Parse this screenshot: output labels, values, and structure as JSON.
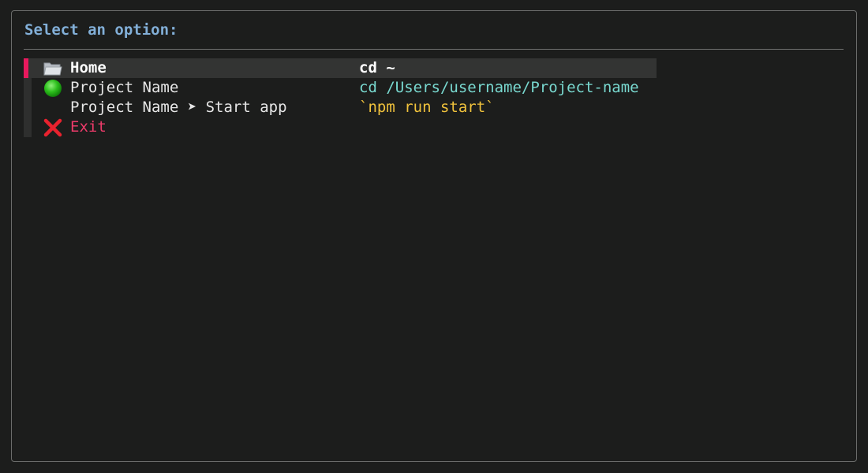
{
  "prompt": {
    "title": "Select an option:"
  },
  "menu": {
    "items": [
      {
        "icon": "folder-icon",
        "label": "Home",
        "command": "cd ~",
        "selected": true
      },
      {
        "icon": "green-circle-icon",
        "label": "Project Name",
        "command": "cd /Users/username/Project-name",
        "selected": false
      },
      {
        "icon": "",
        "label": "Project Name ➤ Start app",
        "command": "`npm run start`",
        "selected": false
      },
      {
        "icon": "cross-mark-icon",
        "label": "Exit",
        "command": "",
        "selected": false
      }
    ]
  },
  "colors": {
    "background": "#1c1d1c",
    "title": "#82afd8",
    "selection_bar": "#e8195d",
    "selection_bg": "#333433",
    "command": "#79d9d0",
    "code_command": "#f0c23c",
    "exit": "#ed3b6a"
  }
}
